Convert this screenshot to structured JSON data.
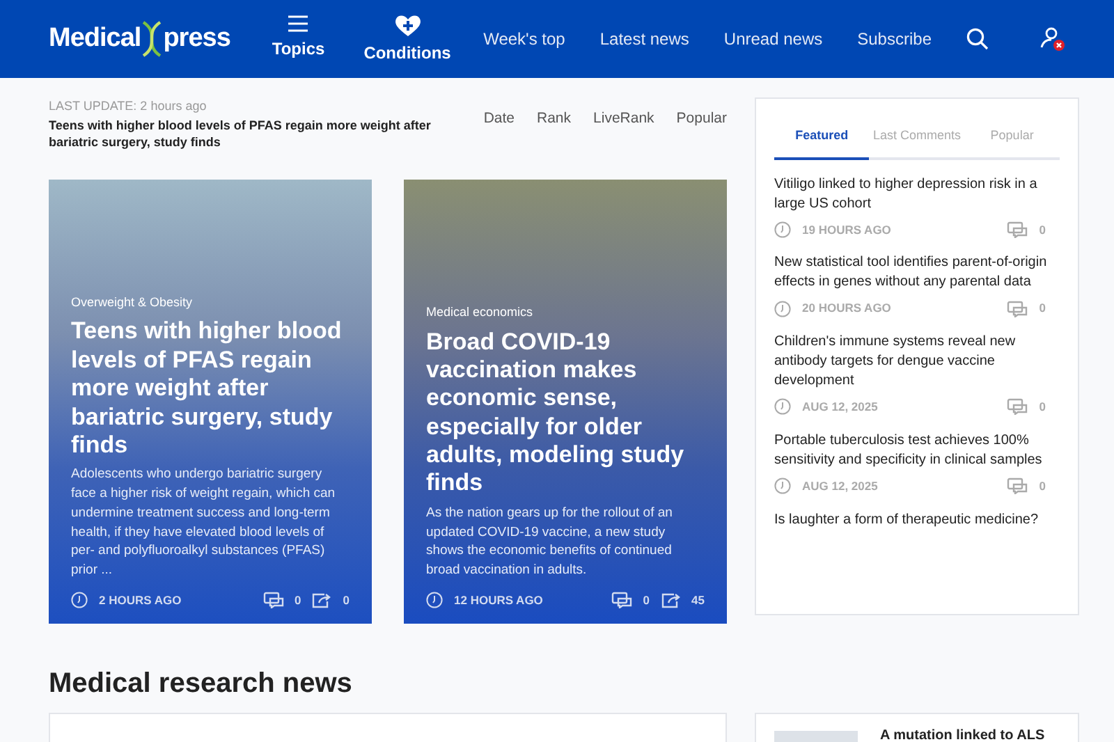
{
  "header": {
    "logo_left": "Medical",
    "logo_right": "press",
    "nav_buttons": [
      {
        "kind": "menu",
        "label": "Topics"
      },
      {
        "kind": "heart",
        "label": "Conditions"
      }
    ],
    "links": [
      "Week's top",
      "Latest news",
      "Unread news",
      "Subscribe"
    ]
  },
  "update": {
    "label": "LAST UPDATE: 2 hours ago",
    "headline": "Teens with higher blood levels of PFAS regain more weight after bariatric surgery, study finds"
  },
  "sort_links": [
    "Date",
    "Rank",
    "LiveRank",
    "Popular"
  ],
  "cards": [
    {
      "category": "Overweight & Obesity",
      "title": "Teens with higher blood levels of PFAS regain more weight after bariatric surgery, study finds",
      "summary": "Adolescents who undergo bariatric surgery face a higher risk of weight regain, which can undermine treatment success and long-term health, if they have elevated blood levels of per- and polyfluoroalkyl substances (PFAS) prior ...",
      "time": "2 HOURS AGO",
      "comments": "0",
      "shares": "0"
    },
    {
      "category": "Medical economics",
      "title": "Broad COVID-19 vaccination makes economic sense, especially for older adults, modeling study finds",
      "summary": "As the nation gears up for the rollout of an updated COVID-19 vaccine, a new study shows the economic benefits of continued broad vaccination in adults.",
      "time": "12 HOURS AGO",
      "comments": "0",
      "shares": "45"
    }
  ],
  "sidebar": {
    "tabs": [
      {
        "label": "Featured",
        "selected": true
      },
      {
        "label": "Last Comments",
        "selected": false
      },
      {
        "label": "Popular",
        "selected": false
      }
    ],
    "items": [
      {
        "title": "Vitiligo linked to higher depression risk in a large US cohort",
        "time": "19 HOURS AGO",
        "comments": "0"
      },
      {
        "title": "New statistical tool identifies parent-of-origin effects in genes without any parental data",
        "time": "20 HOURS AGO",
        "comments": "0"
      },
      {
        "title": "Children's immune systems reveal new antibody targets for dengue vaccine development",
        "time": "AUG 12, 2025",
        "comments": "0"
      },
      {
        "title": "Portable tuberculosis test achieves 100% sensitivity and specificity in clinical samples",
        "time": "AUG 12, 2025",
        "comments": "0"
      },
      {
        "title": "Is laughter a form of therapeutic medicine?"
      }
    ]
  },
  "section_title": "Medical research news",
  "side_story": {
    "title": "A mutation linked to ALS"
  }
}
